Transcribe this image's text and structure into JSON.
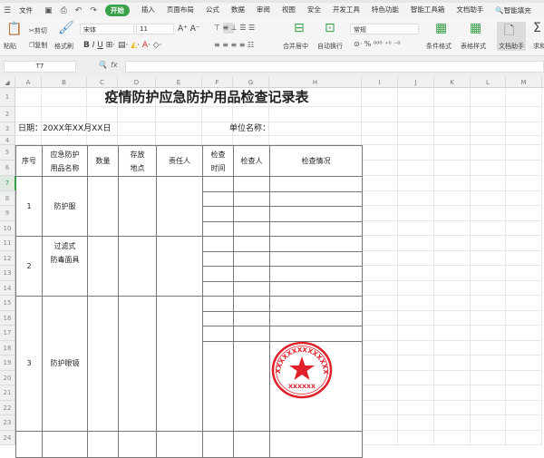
{
  "tabs": {
    "file": "文件",
    "items": [
      "开始",
      "插入",
      "页面布局",
      "公式",
      "数据",
      "审阅",
      "视图",
      "安全",
      "开发工具",
      "特色功能",
      "智能工具箱",
      "文档助手"
    ],
    "active": "开始",
    "search": "智能填充"
  },
  "ribbon": {
    "paste": "粘贴",
    "cut": "剪切",
    "copy": "复制",
    "format_painter": "格式刷",
    "font": "宋体",
    "size": "11",
    "merge": "合并居中",
    "wrap": "自动换行",
    "number_format": "常规",
    "cond_format": "条件格式",
    "table_style": "表格样式",
    "doc_helper": "文档助手",
    "sum": "求和"
  },
  "formula": {
    "namebox": "T7",
    "fx": "fx",
    "value": ""
  },
  "columns": [
    "A",
    "B",
    "C",
    "D",
    "E",
    "F",
    "G",
    "H",
    "I",
    "J",
    "K",
    "L",
    "M"
  ],
  "sheet": {
    "title": "疫情防护应急防护用品检查记录表",
    "date": "日期：20XX年XX月XX日",
    "unit": "单位名称：",
    "headers": [
      "序号",
      "应急防护\n用品名称",
      "数量",
      "存放\n地点",
      "责任人",
      "检查\n时间",
      "检查人",
      "检查情况"
    ],
    "rows": [
      {
        "no": "1",
        "name": "防护服"
      },
      {
        "no": "2",
        "name": "过滤式\n防毒面具"
      },
      {
        "no": "3",
        "name": "防护眼镜"
      }
    ],
    "stamp": "XXXXXXXXXXXXXXXXXX",
    "stamp_bottom": "XXXXXX"
  },
  "colors": {
    "accent": "#3aa14a",
    "stamp": "#e0202a"
  }
}
